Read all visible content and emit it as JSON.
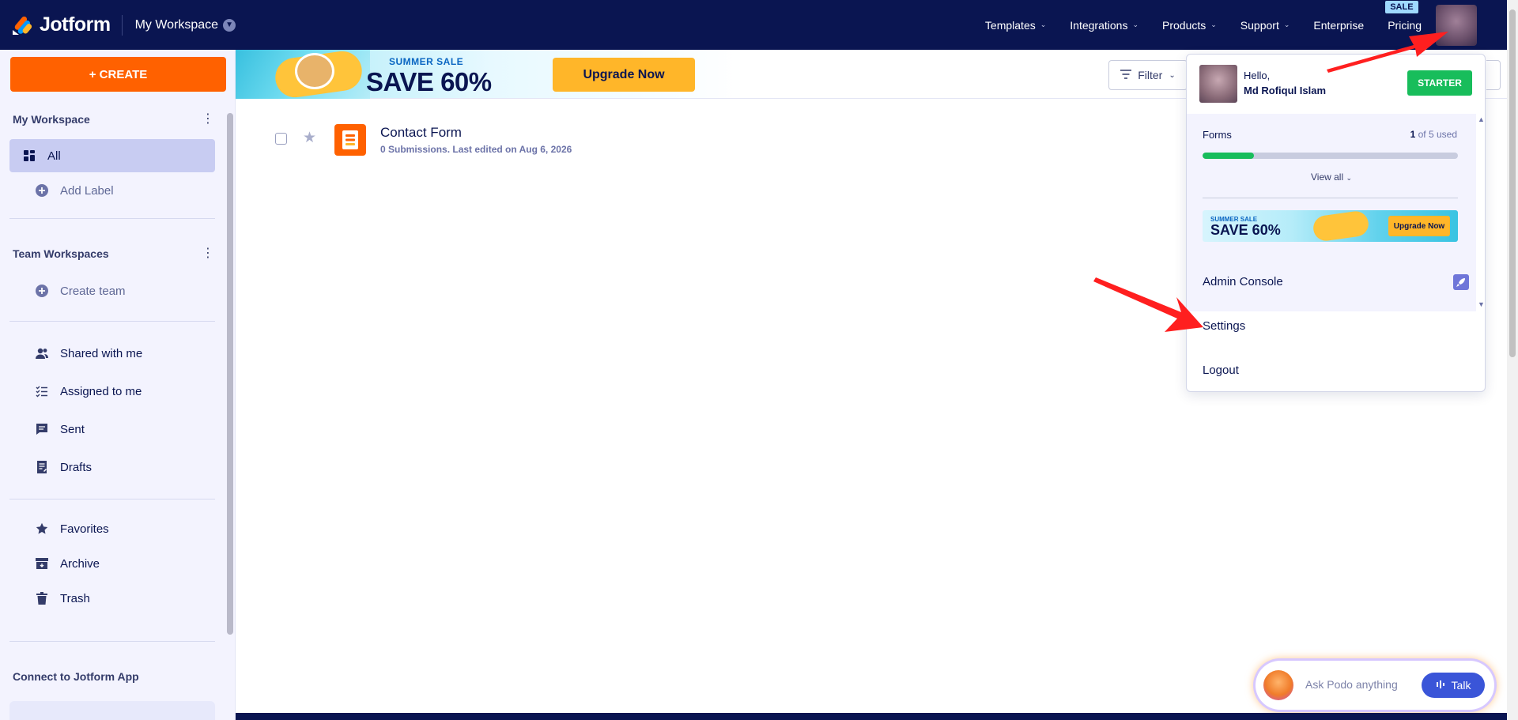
{
  "nav": {
    "logo_text": "Jotform",
    "workspace_title": "My Workspace",
    "links": [
      {
        "label": "Templates",
        "has_caret": true
      },
      {
        "label": "Integrations",
        "has_caret": true
      },
      {
        "label": "Products",
        "has_caret": true
      },
      {
        "label": "Support",
        "has_caret": true
      },
      {
        "label": "Enterprise",
        "has_caret": false
      },
      {
        "label": "Pricing",
        "has_caret": false
      }
    ],
    "sale_badge": "SALE"
  },
  "sidebar": {
    "create_label": "+ CREATE",
    "my_workspace": "My Workspace",
    "all_label": "All",
    "add_label": "Add Label",
    "team_workspaces": "Team Workspaces",
    "create_team": "Create team",
    "shared_with_me": "Shared with me",
    "assigned_to_me": "Assigned to me",
    "sent": "Sent",
    "drafts": "Drafts",
    "favorites": "Favorites",
    "archive": "Archive",
    "trash": "Trash",
    "connect_app": "Connect to Jotform App"
  },
  "promo": {
    "sub": "SUMMER SALE",
    "big": "SAVE 60%",
    "button": "Upgrade Now"
  },
  "toolbar": {
    "filter_label": "Filter"
  },
  "forms": [
    {
      "title": "Contact Form",
      "meta": "0 Submissions. Last edited on Aug 6, 2026"
    }
  ],
  "account_menu": {
    "hello": "Hello,",
    "name": "Md Rofiqul Islam",
    "plan": "STARTER",
    "forms_label": "Forms",
    "forms_used_count": "1",
    "forms_used_rest": " of 5 used",
    "forms_used_fraction": 0.2,
    "view_all": "View all",
    "mini_promo_sub": "SUMMER SALE",
    "mini_promo_big": "SAVE 60%",
    "mini_promo_button": "Upgrade Now",
    "admin_console": "Admin Console",
    "settings": "Settings",
    "logout": "Logout"
  },
  "podo": {
    "placeholder": "Ask Podo anything",
    "talk_label": "Talk"
  },
  "colors": {
    "nav_bg": "#0a1551",
    "create_orange": "#ff6100",
    "upgrade_yellow": "#ffb629",
    "starter_green": "#18bd5b",
    "arrow_red": "#ff1f1f"
  }
}
